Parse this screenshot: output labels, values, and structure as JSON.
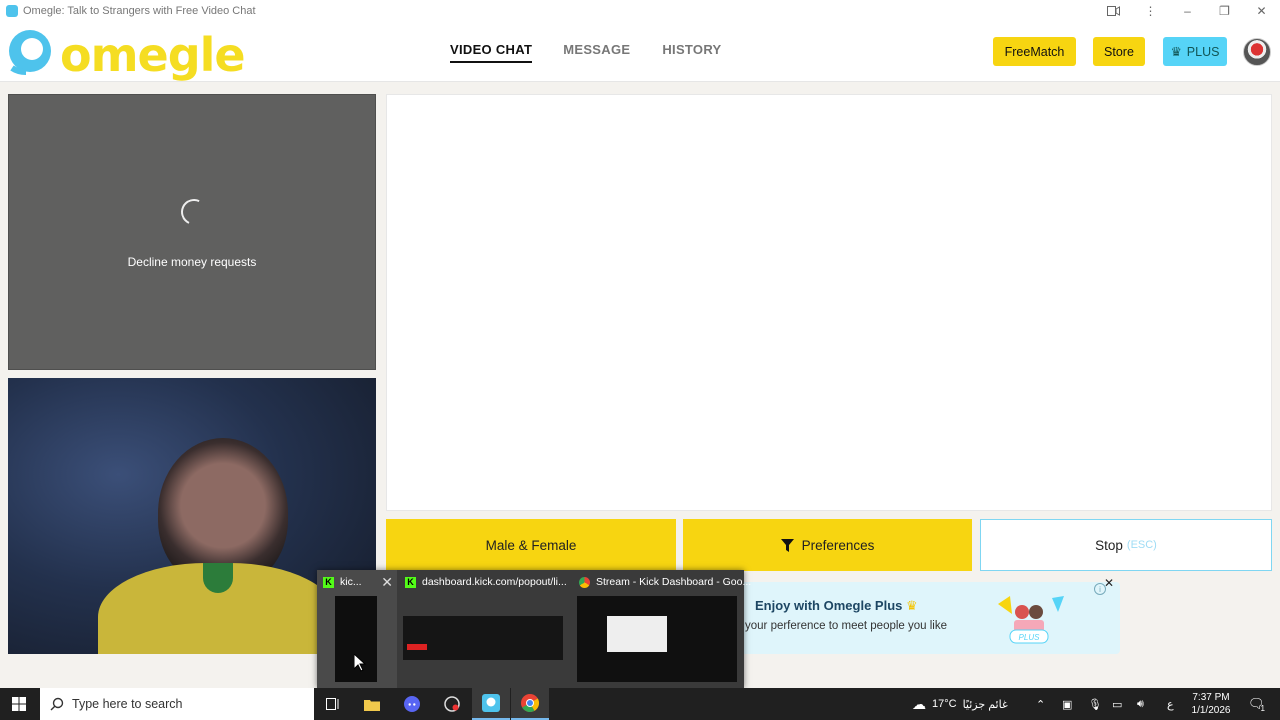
{
  "window": {
    "title": "Omegle: Talk to Strangers with Free Video Chat"
  },
  "header": {
    "logo_text": "omegle",
    "nav": [
      "VIDEO CHAT",
      "MESSAGE",
      "HISTORY"
    ],
    "freematch_label": "FreeMatch",
    "store_label": "Store",
    "plus_label": "PLUS"
  },
  "remote": {
    "message": "Decline money requests"
  },
  "actions": {
    "gender_label": "Male & Female",
    "preferences_label": "Preferences",
    "stop_label": "Stop",
    "stop_hint": "(ESC)"
  },
  "promo": {
    "title": "Enjoy with Omegle Plus",
    "subtitle": "your perference to meet people you like",
    "badge": "PLUS"
  },
  "thumbnails": [
    {
      "title": "kic..."
    },
    {
      "title": "dashboard.kick.com/popout/li..."
    },
    {
      "title": "Stream - Kick Dashboard - Goo..."
    }
  ],
  "taskbar": {
    "search_placeholder": "Type here to search",
    "weather": "17°C",
    "weather_text": "غائم جزئيًا",
    "lang": "ع",
    "time": "7:37 PM",
    "date": "1/1/2026",
    "notification_count": "1"
  },
  "colors": {
    "yellow": "#f7d511",
    "plus_blue": "#56d4f7",
    "logo_blue": "#4ec3ec"
  }
}
